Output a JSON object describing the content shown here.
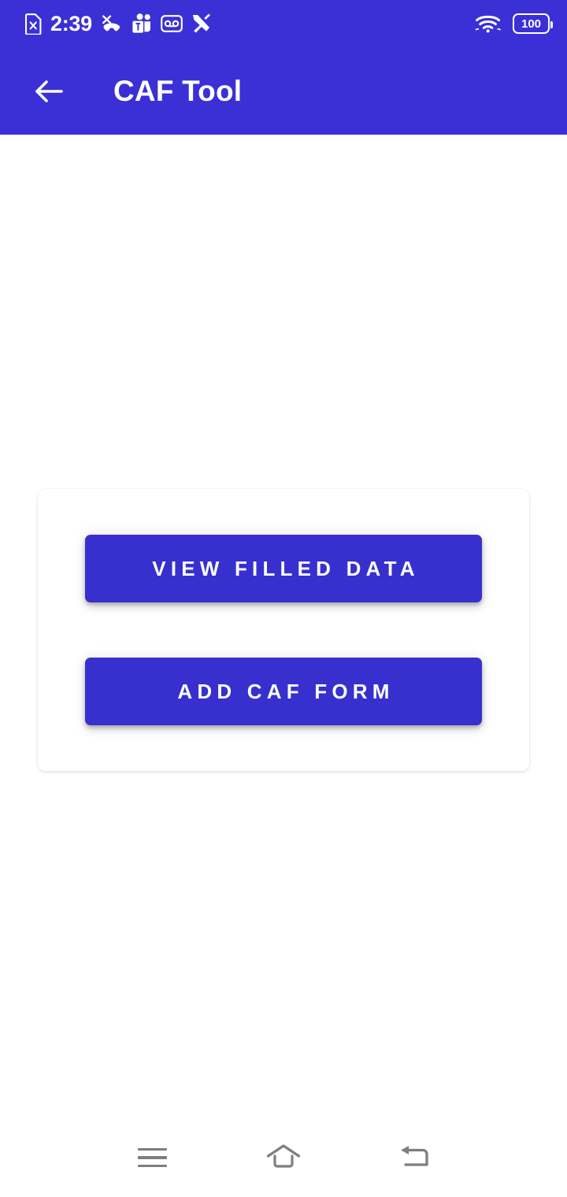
{
  "status_bar": {
    "time": "2:39",
    "battery_level": "100",
    "background_color": "#3A30D6",
    "left_icons": [
      "sim-card-error-icon",
      "missed-call-icon",
      "microsoft-teams-icon",
      "voicemail-icon",
      "developer-tools-icon"
    ],
    "right_icons": [
      "wifi-icon",
      "battery-icon"
    ]
  },
  "app_bar": {
    "title": "CAF Tool",
    "back_icon": "arrow-left-icon",
    "background_color": "#3A30D6",
    "text_color": "#FFFFFF"
  },
  "main": {
    "background_color": "#FFFFFF",
    "card": {
      "background_color": "#FFFFFF",
      "buttons": [
        {
          "label": "VIEW FILLED DATA",
          "name": "view-filled-data-button",
          "color": "#3730CE"
        },
        {
          "label": "ADD CAF FORM",
          "name": "add-caf-form-button",
          "color": "#3730CE"
        }
      ]
    }
  },
  "nav_bar": {
    "background_color": "#FFFFFF",
    "icon_color": "#7E7E7E",
    "buttons": [
      {
        "name": "recents-icon",
        "label": "Recents"
      },
      {
        "name": "home-icon",
        "label": "Home"
      },
      {
        "name": "back-icon",
        "label": "Back"
      }
    ]
  }
}
